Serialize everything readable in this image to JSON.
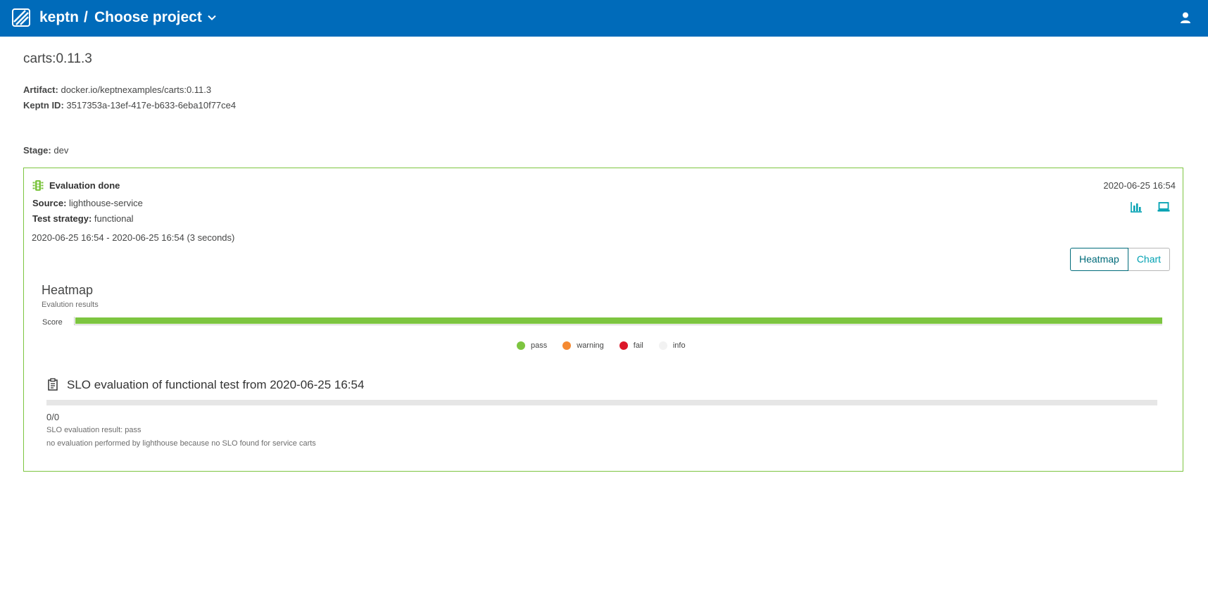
{
  "header": {
    "brand": "keptn",
    "separator": "/",
    "project_label": "Choose project",
    "background_color": "#006bba"
  },
  "artifact": {
    "title": "carts:0.11.3",
    "artifact_label": "Artifact:",
    "artifact_value": "docker.io/keptnexamples/carts:0.11.3",
    "keptn_id_label": "Keptn ID:",
    "keptn_id_value": "3517353a-13ef-417e-b633-6eba10f77ce4",
    "stage_label": "Stage:",
    "stage_value": "dev"
  },
  "evaluation": {
    "title": "Evaluation done",
    "timestamp": "2020-06-25 16:54",
    "source_label": "Source:",
    "source_value": "lighthouse-service",
    "strategy_label": "Test strategy:",
    "strategy_value": "functional",
    "time_range": "2020-06-25 16:54 - 2020-06-25 16:54 (3 seconds)",
    "border_color": "#7dc540",
    "actions": [
      "bar-chart-icon",
      "monitor-icon"
    ],
    "view_toggle": {
      "options": [
        "Heatmap",
        "Chart"
      ],
      "selected": "Heatmap"
    }
  },
  "heatmap": {
    "title": "Heatmap",
    "subtitle": "Evalution results",
    "row_label": "Score",
    "score_fraction": 1.0,
    "score_color": "#7dc540",
    "legend": [
      {
        "label": "pass",
        "color": "#7dc540"
      },
      {
        "label": "warning",
        "color": "#f58a32"
      },
      {
        "label": "fail",
        "color": "#dc172a"
      },
      {
        "label": "info",
        "color": "#f2f2f2"
      }
    ]
  },
  "slo": {
    "title": "SLO evaluation of functional test from 2020-06-25 16:54",
    "score": "0/0",
    "progress_fraction": 0,
    "result": "SLO evaluation result: pass",
    "message": "no evaluation performed by lighthouse because no SLO found for service carts"
  }
}
